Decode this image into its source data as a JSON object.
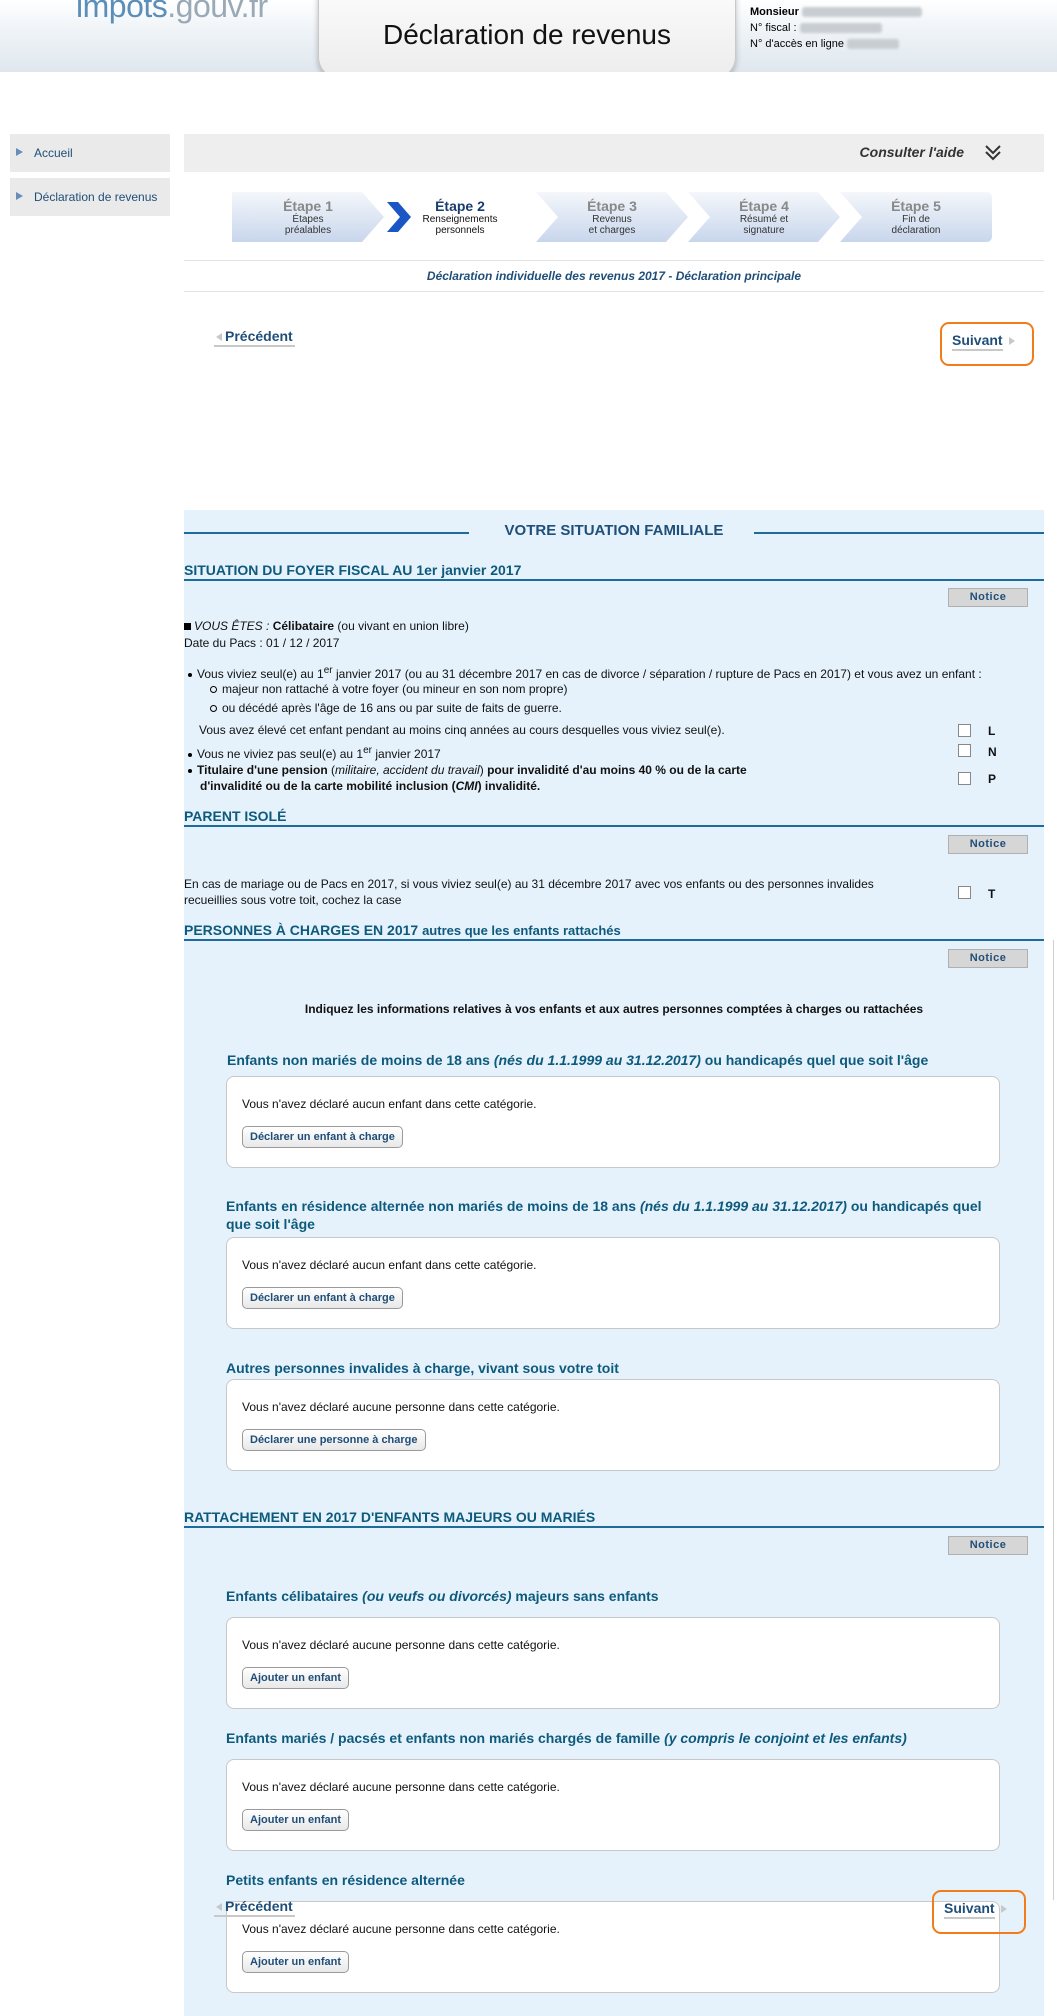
{
  "header": {
    "logo_main": "impots",
    "logo_domain": ".gouv.fr",
    "title": "Déclaration de revenus",
    "user_label": "Monsieur",
    "fiscal_label": "N° fiscal :",
    "access_label": "N° d'accès en ligne"
  },
  "sidebar": {
    "items": [
      {
        "label": "Accueil"
      },
      {
        "label": "Déclaration de revenus"
      }
    ]
  },
  "help": {
    "label": "Consulter l'aide"
  },
  "steps": [
    {
      "num": "Étape 1",
      "desc1": "Étapes",
      "desc2": "préalables"
    },
    {
      "num": "Étape 2",
      "desc1": "Renseignements",
      "desc2": "personnels"
    },
    {
      "num": "Étape 3",
      "desc1": "Revenus",
      "desc2": "et charges"
    },
    {
      "num": "Étape 4",
      "desc1": "Résumé et",
      "desc2": "signature"
    },
    {
      "num": "Étape 5",
      "desc1": "Fin de",
      "desc2": "déclaration"
    }
  ],
  "active_step_index": 1,
  "declaration_line": "Déclaration individuelle des revenus 2017 - Déclaration principale",
  "nav": {
    "prev": "Précédent",
    "next": "Suivant"
  },
  "form": {
    "main_title": "VOTRE SITUATION FAMILIALE",
    "notice": "Notice",
    "situation": {
      "heading": "SITUATION DU FOYER FISCAL AU 1er janvier 2017",
      "vous_etes_label": "VOUS ÊTES :",
      "vous_etes_value": "Célibataire",
      "vous_etes_suffix": "(ou vivant en union libre)",
      "pacs_date": "Date du Pacs : 01 / 12 / 2017",
      "b1_a": "Vous viviez seul(e) au 1",
      "b1_sup": "er",
      "b1_b": " janvier 2017 (ou au 31 décembre 2017 en cas de divorce / séparation / rupture de Pacs en 2017) et vous avez un enfant :",
      "sub1": "majeur non rattaché à votre foyer (ou mineur en son nom propre)",
      "sub2": "ou décédé après l'âge de 16 ans ou par suite de faits de guerre.",
      "raised": "Vous avez élevé cet enfant pendant au moins cinq années au cours desquelles vous viviez seul(e).",
      "b2_a": "Vous ne viviez pas seul(e) au 1",
      "b2_sup": "er",
      "b2_b": " janvier 2017",
      "b3_bold1": "Titulaire d'une pension",
      "b3_ital": "militaire, accident du travail",
      "b3_bold2": "pour invalidité d'au moins 40 % ou de la carte",
      "b3_line2a": "d'invalidité ou de la carte mobilité inclusion (",
      "b3_cmi": "CMI",
      "b3_line2b": ") invalidité.",
      "case_L": "L",
      "case_N": "N",
      "case_P": "P"
    },
    "parent_isole": {
      "heading": "PARENT ISOLÉ",
      "text": "En cas de mariage ou de Pacs en 2017, si vous viviez seul(e) au 31 décembre 2017 avec vos enfants ou des personnes invalides recueillies sous votre toit, cochez la case",
      "case_T": "T"
    },
    "personnes": {
      "heading": "PERSONNES À CHARGES EN 2017",
      "heading_sub": "autres que les enfants rattachés",
      "intro": "Indiquez les informations relatives à vos enfants et aux autres personnes comptées à charges ou rattachées",
      "cat1_a": "Enfants non mariés de moins de 18 ans ",
      "cat1_ital": "(nés du 1.1.1999 au 31.12.2017)",
      "cat1_b": " ou handicapés quel que soit l'âge",
      "cat1_msg": "Vous n'avez déclaré aucun enfant dans cette catégorie.",
      "cat1_btn": "Déclarer un enfant à charge",
      "cat2_a": "Enfants en résidence alternée non mariés de moins de 18 ans ",
      "cat2_ital": "(nés du 1.1.1999 au 31.12.2017)",
      "cat2_b": " ou handicapés quel que soit l'âge",
      "cat2_msg": "Vous n'avez déclaré aucun enfant dans cette catégorie.",
      "cat2_btn": "Déclarer un enfant à charge",
      "cat3": "Autres personnes invalides à charge, vivant sous votre toit",
      "cat3_msg": "Vous n'avez déclaré aucune personne dans cette catégorie.",
      "cat3_btn": "Déclarer une personne à charge"
    },
    "rattachement": {
      "heading": "RATTACHEMENT EN 2017 D'ENFANTS MAJEURS OU MARIÉS",
      "cat1_a": "Enfants célibataires ",
      "cat1_ital": "(ou veufs ou divorcés)",
      "cat1_b": " majeurs sans enfants",
      "cat1_msg": "Vous n'avez déclaré aucune personne dans cette catégorie.",
      "cat1_btn": "Ajouter un enfant",
      "cat2_a": "Enfants mariés / pacsés et enfants non mariés chargés de famille ",
      "cat2_ital": "(y compris le conjoint et les enfants)",
      "cat2_msg": "Vous n'avez déclaré aucune personne dans cette catégorie.",
      "cat2_btn": "Ajouter un enfant",
      "cat3": "Petits enfants en résidence alternée",
      "cat3_msg": "Vous n'avez déclaré aucune personne dans cette catégorie.",
      "cat3_btn": "Ajouter un enfant"
    }
  },
  "colors": {
    "accent_blue": "#1f4e79",
    "section_blue": "#0e5a7d",
    "panel_bg": "#e5f2fb",
    "next_border": "#f07d1a",
    "active_arrow": "#1a56c4"
  }
}
